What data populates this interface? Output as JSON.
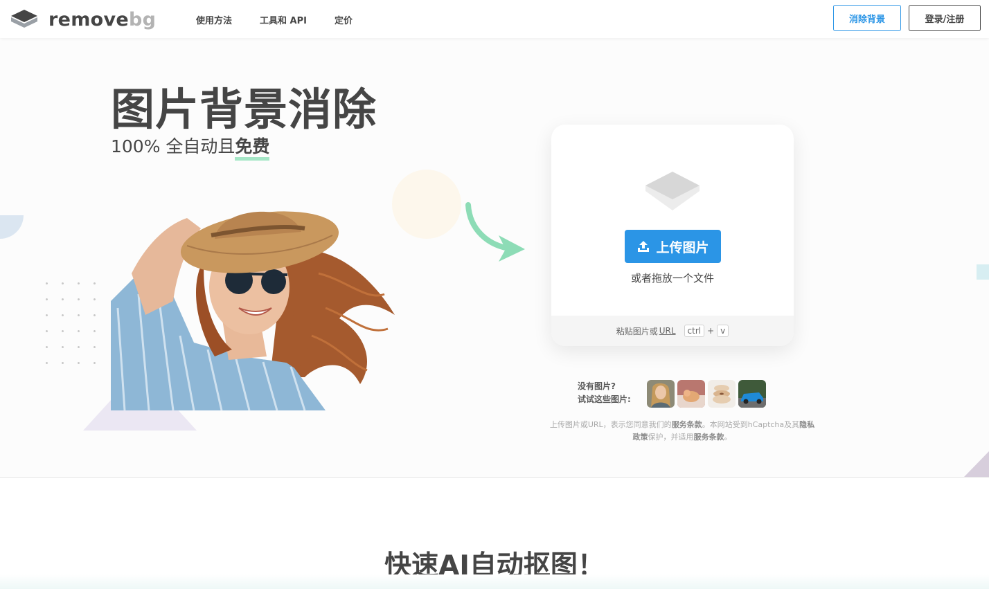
{
  "header": {
    "logo_word1": "remove",
    "logo_word2": "bg",
    "nav": [
      "使用方法",
      "工具和 API",
      "定价"
    ],
    "btn_remove": "消除背景",
    "btn_login": "登录/注册"
  },
  "hero": {
    "title": "图片背景消除",
    "subtitle_prefix": "100% 全自动且",
    "subtitle_free": "免费"
  },
  "upload": {
    "button_label": "上传图片",
    "drop_text": "或者拖放一个文件",
    "paste_prefix": "粘贴图片或",
    "paste_url": "URL",
    "key_ctrl": "ctrl",
    "key_plus": "+",
    "key_v": "v"
  },
  "samples": {
    "line1": "没有图片?",
    "line2": "试试这些图片:",
    "items": [
      "woman-sample",
      "cat-sample",
      "donut-sample",
      "car-sample"
    ]
  },
  "legal": {
    "t1": "上传图片或URL，表示您同意我们的",
    "terms1": "服务条款",
    "t2": "。本网站受到hCaptcha及其",
    "privacy": "隐私政策",
    "t3": "保护，并适用",
    "terms2": "服务条款",
    "t4": "。"
  },
  "section": {
    "title": "快速AI自动抠图！"
  },
  "colors": {
    "accent_blue": "#2b95e6",
    "text_dark": "#454545",
    "underline_green": "#a5e6c6",
    "arrow_green": "#8ddcb6"
  }
}
